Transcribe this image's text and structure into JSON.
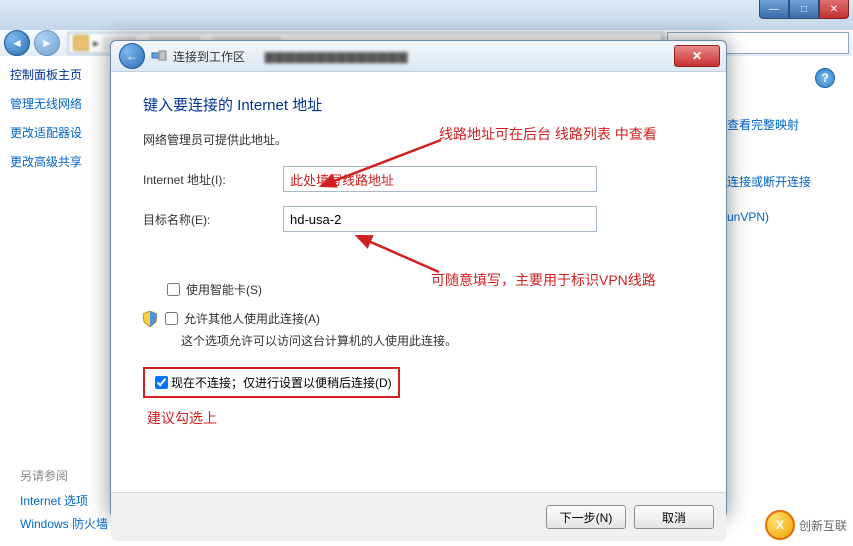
{
  "outer_window": {
    "minimize": "—",
    "maximize": "□",
    "close": "✕"
  },
  "left_pane": {
    "heading": "控制面板主页",
    "links": [
      "管理无线网络",
      "更改适配器设",
      "更改高级共享"
    ]
  },
  "help_tooltip": "?",
  "right_links": [
    "查看完整映射",
    "连接或断开连接",
    "unVPN)"
  ],
  "wizard": {
    "back_arrow": "←",
    "title": "连接到工作区",
    "close": "✕",
    "heading": "键入要连接的 Internet 地址",
    "sub": "网络管理员可提供此地址。",
    "internet_label": "Internet 地址(I):",
    "internet_value": "此处填写线路地址",
    "dest_label": "目标名称(E):",
    "dest_value": "hd-usa-2",
    "smartcard_label": "使用智能卡(S)",
    "allow_label": "允许其他人使用此连接(A)",
    "allow_hint": "这个选项允许可以访问这台计算机的人使用此连接。",
    "defer_label": "现在不连接；仅进行设置以便稍后连接(D)",
    "next": "下一步(N)",
    "cancel": "取消"
  },
  "annotations": {
    "top_note": "线路地址可在后台 线路列表 中查看",
    "mid_note": "可随意填写，主要用于标识VPN线路",
    "bottom_note": "建议勾选上"
  },
  "footer": {
    "section": "另请参阅",
    "links": [
      "Internet 选项",
      "Windows 防火墙"
    ]
  },
  "logo": {
    "letter": "X",
    "text": "创新互联"
  }
}
